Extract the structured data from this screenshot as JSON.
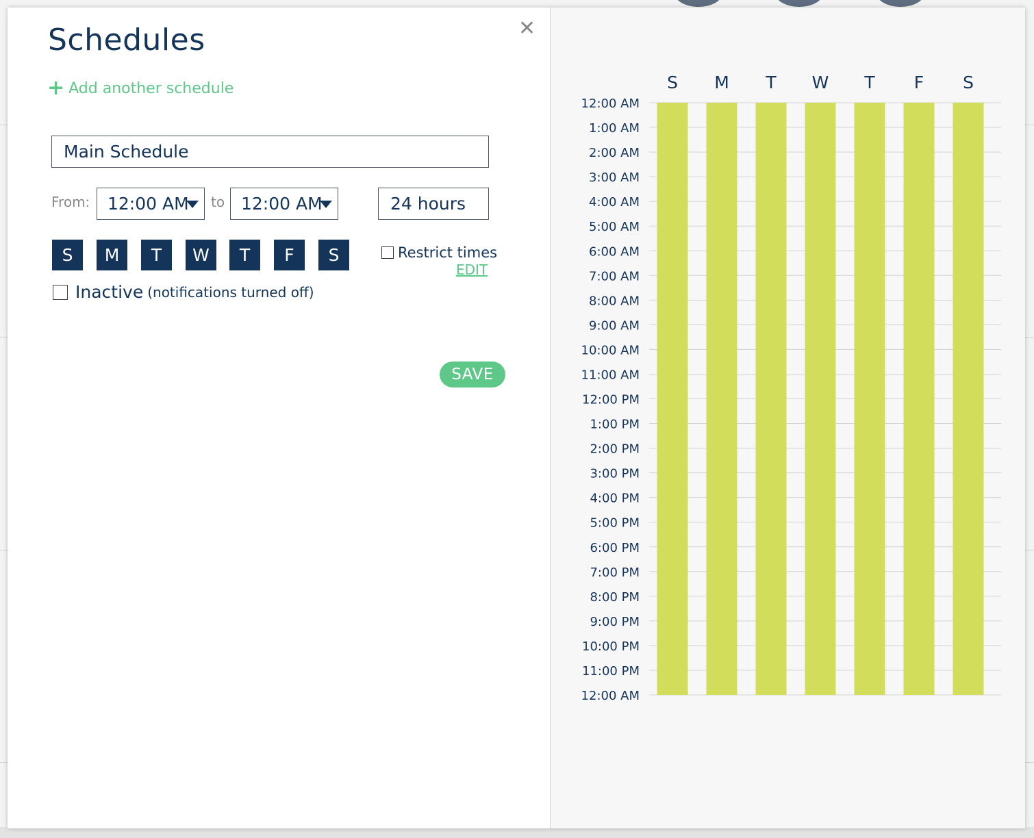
{
  "modal": {
    "title": "Schedules",
    "close_icon": "close-icon",
    "add_schedule_label": "Add another schedule",
    "schedule_name": "Main Schedule",
    "from_label": "From:",
    "to_label": "to",
    "from_time": "12:00 AM",
    "to_time": "12:00 AM",
    "duration": "24 hours",
    "days": [
      "S",
      "M",
      "T",
      "W",
      "T",
      "F",
      "S"
    ],
    "restrict_label": "Restrict times",
    "edit_label": "EDIT",
    "inactive_label": "Inactive",
    "inactive_note": "(notifications turned off)",
    "save_label": "SAVE"
  },
  "colors": {
    "primary_navy": "#14345a",
    "accent_green": "#5ec889",
    "bar_lime": "#d2dd5c"
  },
  "chart_data": {
    "type": "bar",
    "categories": [
      "S",
      "M",
      "T",
      "W",
      "T",
      "F",
      "S"
    ],
    "y_labels": [
      "12:00 AM",
      "1:00 AM",
      "2:00 AM",
      "3:00 AM",
      "4:00 AM",
      "5:00 AM",
      "6:00 AM",
      "7:00 AM",
      "8:00 AM",
      "9:00 AM",
      "10:00 AM",
      "11:00 AM",
      "12:00 PM",
      "1:00 PM",
      "2:00 PM",
      "3:00 PM",
      "4:00 PM",
      "5:00 PM",
      "6:00 PM",
      "7:00 PM",
      "8:00 PM",
      "9:00 PM",
      "10:00 PM",
      "11:00 PM",
      "12:00 AM"
    ],
    "series": [
      {
        "start_hour": [
          0,
          0,
          0,
          0,
          0,
          0,
          0
        ],
        "end_hour": [
          24,
          24,
          24,
          24,
          24,
          24,
          24
        ]
      }
    ],
    "ylim": [
      0,
      24
    ],
    "grid": true
  }
}
